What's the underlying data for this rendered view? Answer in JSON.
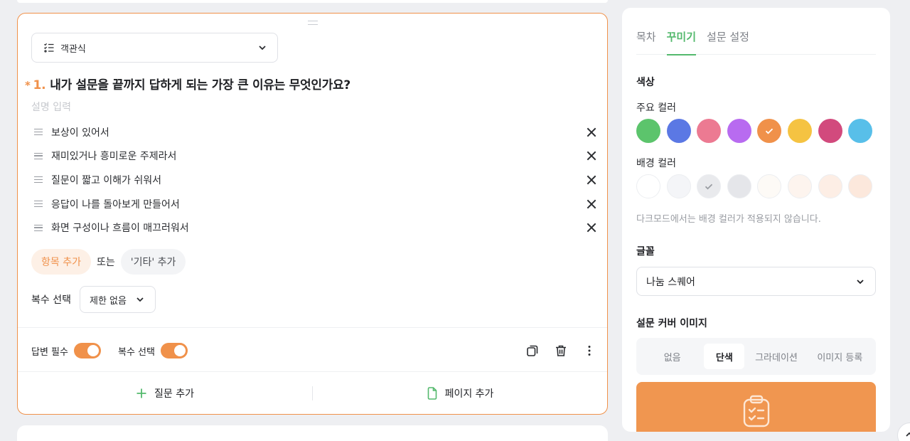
{
  "question": {
    "type_label": "객관식",
    "required_mark": "*",
    "number": "1.",
    "title": "내가 설문을 끝까지 답하게 되는 가장 큰 이유는 무엇인가요?",
    "description_placeholder": "설명 입력",
    "options": [
      "보상이 있어서",
      "재미있거나 흥미로운 주제라서",
      "질문이 짧고 이해가 쉬워서",
      "응답이 나를 돌아보게 만들어서",
      "화면 구성이나 흐름이 매끄러워서"
    ],
    "add_option_label": "항목 추가",
    "or_label": "또는",
    "add_other_label": "'기타' 추가",
    "multi_select_label": "복수 선택",
    "multi_select_value": "제한 없음",
    "footer": {
      "required_label": "답변 필수",
      "required_on": true,
      "multi_label": "복수 선택",
      "multi_on": true
    },
    "add_question_label": "질문 추가",
    "add_page_label": "페이지 추가"
  },
  "panel": {
    "tabs": [
      "목차",
      "꾸미기",
      "설문 설정"
    ],
    "active_tab": 1,
    "color_section_title": "색상",
    "primary_color_label": "주요 컬러",
    "primary_colors": [
      "#5cc46c",
      "#5b78e4",
      "#ec7a92",
      "#b86bf0",
      "#f0914a",
      "#f5c342",
      "#d24a7d",
      "#58bfe9"
    ],
    "primary_selected": 4,
    "bg_color_label": "배경 컬러",
    "bg_colors": [
      "#ffffff",
      "#f4f5f8",
      "#e9eaed",
      "#e5e6ea",
      "#fdfaf6",
      "#fdf4ee",
      "#fdeee5",
      "#fce8dc"
    ],
    "bg_selected": 2,
    "dark_mode_note": "다크모드에서는 배경 컬러가 적용되지 않습니다.",
    "font_section_title": "글꼴",
    "font_value": "나눔 스퀘어",
    "cover_section_title": "설문 커버 이미지",
    "cover_options": [
      "없음",
      "단색",
      "그라데이션",
      "이미지 등록"
    ],
    "cover_selected": 1,
    "cover_color": "#f09650"
  },
  "colors": {
    "accent": "#f0914a",
    "tab_active": "#54b96d",
    "add_icon": "#54b96d"
  },
  "icons": {
    "type": "checklist-icon",
    "option_drag": "drag-handle-icon",
    "option_remove": "close-icon",
    "copy": "copy-icon",
    "delete": "trash-icon",
    "more": "more-vertical-icon",
    "add_question": "plus-icon",
    "add_page": "page-icon",
    "cover": "clipboard-icon"
  }
}
